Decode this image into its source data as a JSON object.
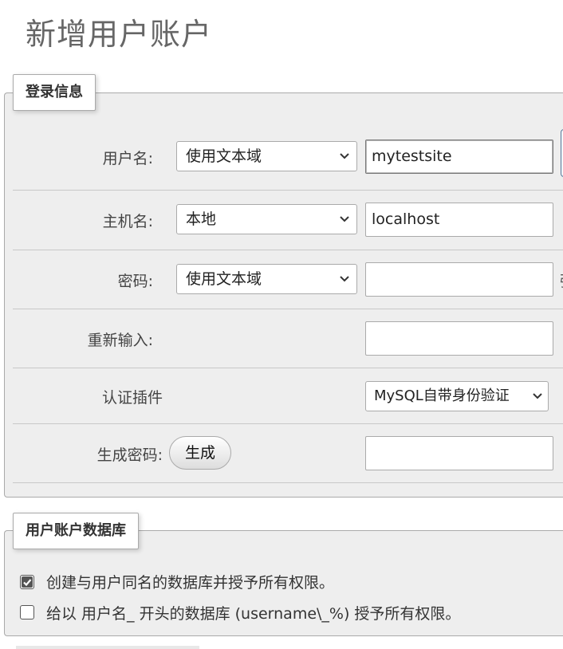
{
  "page": {
    "title": "新增用户账户"
  },
  "login_info": {
    "legend": "登录信息",
    "username": {
      "label": "用户名:",
      "select_value": "使用文本域",
      "input_value": "mytestsite"
    },
    "hostname": {
      "label": "主机名:",
      "select_value": "本地",
      "input_value": "localhost"
    },
    "password": {
      "label": "密码:",
      "select_value": "使用文本域",
      "input_value": "",
      "side_glyph": "强"
    },
    "reenter": {
      "label": "重新输入:",
      "input_value": ""
    },
    "auth_plugin": {
      "label": "认证插件",
      "select_value": "MySQL自带身份验证"
    },
    "generate_password": {
      "label": "生成密码:",
      "button_label": "生成",
      "input_value": ""
    }
  },
  "user_db": {
    "legend": "用户账户数据库",
    "options": [
      {
        "label": "创建与用户同名的数据库并授予所有权限。",
        "checked": true
      },
      {
        "label": "给以 用户名_ 开头的数据库 (username\\_%) 授予所有权限。",
        "checked": false
      }
    ]
  }
}
